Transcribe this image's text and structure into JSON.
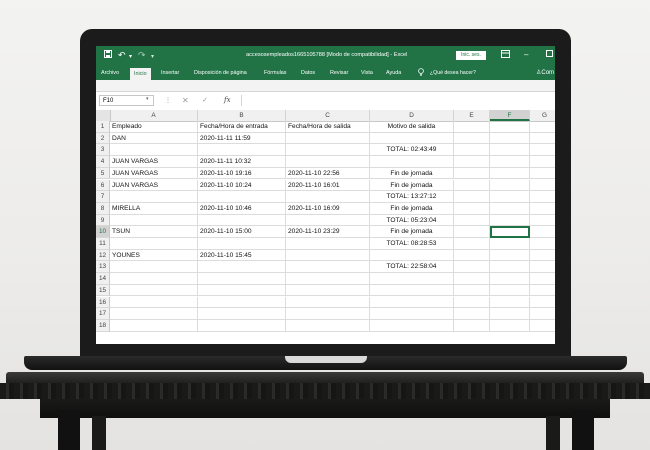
{
  "window": {
    "title": "accesosempleados1665105788  [Modo de compatibilidad]  -  Excel",
    "sign_in": "Inic. ses."
  },
  "ribbon": {
    "tabs": [
      "Archivo",
      "Inicio",
      "Insertar",
      "Disposición de página",
      "Fórmulas",
      "Datos",
      "Revisar",
      "Vista",
      "Ayuda"
    ],
    "active_tab": "Inicio",
    "tell_me": "¿Qué desea hacer?",
    "share": "Com"
  },
  "formula_bar": {
    "name_box": "F10",
    "fx": "fx",
    "content": ""
  },
  "sheet": {
    "columns": [
      "A",
      "B",
      "C",
      "D",
      "E",
      "F",
      "G"
    ],
    "selected_column": "F",
    "selected_row": 10,
    "rows": [
      {
        "num": "1",
        "cells": [
          "Empleado",
          "Fecha/Hora de entrada",
          "Fecha/Hora de salida",
          "Motivo de salida",
          "",
          "",
          ""
        ]
      },
      {
        "num": "2",
        "cells": [
          "DAN",
          "2020-11-11 11:59",
          "",
          "",
          "",
          "",
          ""
        ]
      },
      {
        "num": "3",
        "cells": [
          "",
          "",
          "",
          "TOTAL: 02:43:49",
          "",
          "",
          ""
        ]
      },
      {
        "num": "4",
        "cells": [
          "JUAN VARGAS",
          "2020-11-11 10:32",
          "",
          "",
          "",
          "",
          ""
        ]
      },
      {
        "num": "5",
        "cells": [
          "JUAN VARGAS",
          "2020-11-10 19:16",
          "2020-11-10 22:56",
          "Fin de jornada",
          "",
          "",
          ""
        ]
      },
      {
        "num": "6",
        "cells": [
          "JUAN VARGAS",
          "2020-11-10 10:24",
          "2020-11-10 16:01",
          "Fin de jornada",
          "",
          "",
          ""
        ]
      },
      {
        "num": "7",
        "cells": [
          "",
          "",
          "",
          "TOTAL: 13:27:12",
          "",
          "",
          ""
        ]
      },
      {
        "num": "8",
        "cells": [
          "MIRELLA",
          "2020-11-10 10:46",
          "2020-11-10 16:09",
          "Fin de jornada",
          "",
          "",
          ""
        ]
      },
      {
        "num": "9",
        "cells": [
          "",
          "",
          "",
          "TOTAL: 05:23:04",
          "",
          "",
          ""
        ]
      },
      {
        "num": "10",
        "cells": [
          "TSUN",
          "2020-11-10 15:00",
          "2020-11-10 23:29",
          "Fin de jornada",
          "",
          "",
          ""
        ]
      },
      {
        "num": "11",
        "cells": [
          "",
          "",
          "",
          "TOTAL: 08:28:53",
          "",
          "",
          ""
        ]
      },
      {
        "num": "12",
        "cells": [
          "YOUNES",
          "2020-11-10 15:45",
          "",
          "",
          "",
          "",
          ""
        ]
      },
      {
        "num": "13",
        "cells": [
          "",
          "",
          "",
          "TOTAL: 22:58:04",
          "",
          "",
          ""
        ]
      },
      {
        "num": "14",
        "cells": [
          "",
          "",
          "",
          "",
          "",
          "",
          ""
        ]
      },
      {
        "num": "15",
        "cells": [
          "",
          "",
          "",
          "",
          "",
          "",
          ""
        ]
      },
      {
        "num": "16",
        "cells": [
          "",
          "",
          "",
          "",
          "",
          "",
          ""
        ]
      },
      {
        "num": "17",
        "cells": [
          "",
          "",
          "",
          "",
          "",
          "",
          ""
        ]
      },
      {
        "num": "18",
        "cells": [
          "",
          "",
          "",
          "",
          "",
          "",
          ""
        ]
      }
    ]
  },
  "icons": {
    "save": "save-icon",
    "undo": "undo-icon",
    "redo": "redo-icon",
    "ribbon_display": "ribbon-display-icon",
    "minimize": "minimize-icon",
    "maximize": "maximize-icon",
    "lightbulb": "lightbulb-icon",
    "share": "user-icon"
  },
  "colors": {
    "excel_green": "#217346"
  }
}
